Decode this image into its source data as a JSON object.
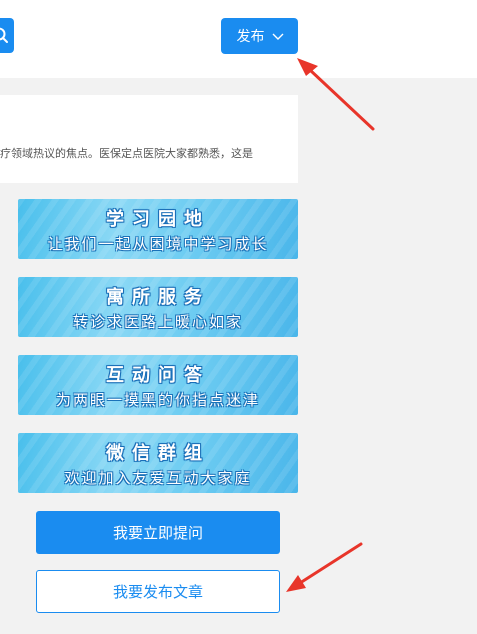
{
  "header": {
    "search_icon": "search-icon",
    "publish_label": "发布",
    "publish_icon": "chevron-down-icon"
  },
  "article": {
    "snippet": "疗领域热议的焦点。医保定点医院大家都熟悉，这是"
  },
  "banners": [
    {
      "title": "学习园地",
      "subtitle": "让我们一起从困境中学习成长"
    },
    {
      "title": "寓所服务",
      "subtitle": "转诊求医路上暖心如家"
    },
    {
      "title": "互动问答",
      "subtitle": "为两眼一摸黑的你指点迷津"
    },
    {
      "title": "微信群组",
      "subtitle": "欢迎加入友爱互动大家庭"
    }
  ],
  "actions": {
    "ask_label": "我要立即提问",
    "post_label": "我要发布文章"
  },
  "colors": {
    "accent": "#1a8cf0",
    "annotation_arrow": "#e8352a",
    "background": "#f2f2f2"
  }
}
